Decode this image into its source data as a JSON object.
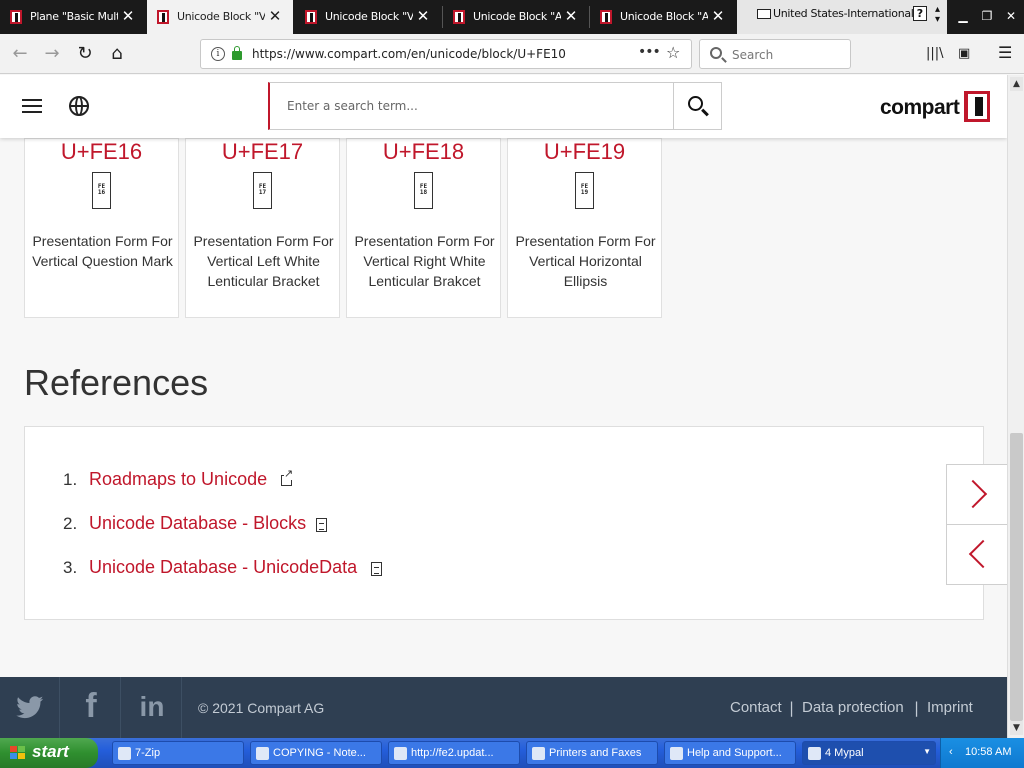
{
  "browser": {
    "tabs": [
      {
        "title": "Plane \"Basic Multil",
        "active": false
      },
      {
        "title": "Unicode Block \"Ver",
        "active": true
      },
      {
        "title": "Unicode Block \"Ve",
        "active": false
      },
      {
        "title": "Unicode Block \"Ara",
        "active": false
      },
      {
        "title": "Unicode Block \"Alp",
        "active": false
      }
    ],
    "close_glyph": "✕",
    "keyboard_layout": "United States-International",
    "keyboard_help": "?",
    "url": "https://www.compart.com/en/unicode/block/U+FE10",
    "page_actions": "•••",
    "search_placeholder": "Search"
  },
  "site": {
    "search_placeholder": "Enter a search term...",
    "logo_text": "compart",
    "brand_color": "#c0172b"
  },
  "cards": [
    {
      "code": "U+FE16",
      "glyph": "FE\n16",
      "name": "Presentation Form For Vertical Question Mark"
    },
    {
      "code": "U+FE17",
      "glyph": "FE\n17",
      "name": "Presentation Form For Vertical Left White Lenticular Bracket"
    },
    {
      "code": "U+FE18",
      "glyph": "FE\n18",
      "name": "Presentation Form For Vertical Right White Lenticular Brakcet"
    },
    {
      "code": "U+FE19",
      "glyph": "FE\n19",
      "name": "Presentation Form For Vertical Horizontal Ellipsis"
    }
  ],
  "references": {
    "heading": "References",
    "items": [
      {
        "num": "1.",
        "label": "Roadmaps to Unicode",
        "icon": "external-link-icon"
      },
      {
        "num": "2.",
        "label": "Unicode Database - Blocks",
        "icon": "document-icon"
      },
      {
        "num": "3.",
        "label": "Unicode Database - UnicodeData",
        "icon": "document-icon"
      }
    ]
  },
  "footer": {
    "social": [
      "twitter-icon",
      "facebook-icon",
      "linkedin-icon"
    ],
    "copyright": "© 2021 Compart AG",
    "links": [
      "Contact",
      "Data protection",
      "Imprint"
    ],
    "separator": "|"
  },
  "taskbar": {
    "start_label": "start",
    "tasks": [
      "7-Zip",
      "COPYING - Note...",
      "http://fe2.updat...",
      "Printers and Faxes",
      "Help and Support...",
      "4 Mypal"
    ],
    "clock": "10:58 AM"
  }
}
